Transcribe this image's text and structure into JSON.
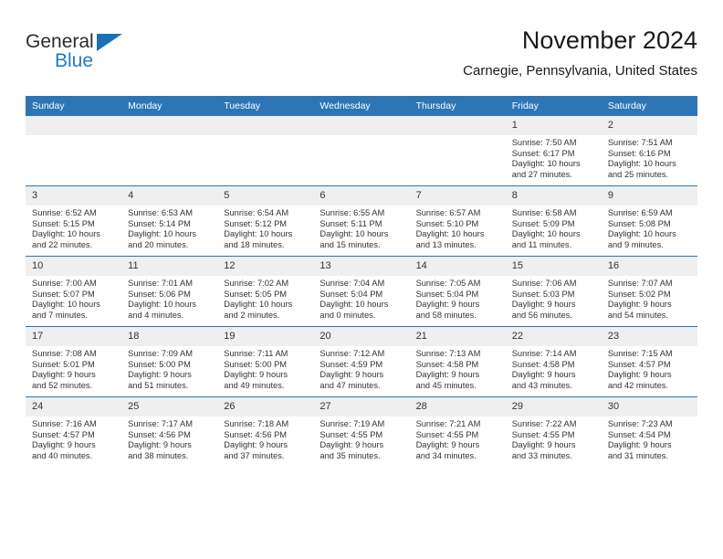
{
  "brand": {
    "logo_text_1": "General",
    "logo_text_2": "Blue",
    "logo_triangle_icon": "triangle-icon",
    "accent_color": "#2e75b6",
    "logo_blue": "#1e7ac4"
  },
  "header": {
    "title": "November 2024",
    "subtitle": "Carnegie, Pennsylvania, United States"
  },
  "calendar": {
    "weekday_headers": [
      "Sunday",
      "Monday",
      "Tuesday",
      "Wednesday",
      "Thursday",
      "Friday",
      "Saturday"
    ],
    "header_bg": "#2e75b6",
    "daynum_bg": "#efefef",
    "weeks": [
      [
        {
          "day": "",
          "lines": []
        },
        {
          "day": "",
          "lines": []
        },
        {
          "day": "",
          "lines": []
        },
        {
          "day": "",
          "lines": []
        },
        {
          "day": "",
          "lines": []
        },
        {
          "day": "1",
          "lines": [
            "Sunrise: 7:50 AM",
            "Sunset: 6:17 PM",
            "Daylight: 10 hours",
            "and 27 minutes."
          ]
        },
        {
          "day": "2",
          "lines": [
            "Sunrise: 7:51 AM",
            "Sunset: 6:16 PM",
            "Daylight: 10 hours",
            "and 25 minutes."
          ]
        }
      ],
      [
        {
          "day": "3",
          "lines": [
            "Sunrise: 6:52 AM",
            "Sunset: 5:15 PM",
            "Daylight: 10 hours",
            "and 22 minutes."
          ]
        },
        {
          "day": "4",
          "lines": [
            "Sunrise: 6:53 AM",
            "Sunset: 5:14 PM",
            "Daylight: 10 hours",
            "and 20 minutes."
          ]
        },
        {
          "day": "5",
          "lines": [
            "Sunrise: 6:54 AM",
            "Sunset: 5:12 PM",
            "Daylight: 10 hours",
            "and 18 minutes."
          ]
        },
        {
          "day": "6",
          "lines": [
            "Sunrise: 6:55 AM",
            "Sunset: 5:11 PM",
            "Daylight: 10 hours",
            "and 15 minutes."
          ]
        },
        {
          "day": "7",
          "lines": [
            "Sunrise: 6:57 AM",
            "Sunset: 5:10 PM",
            "Daylight: 10 hours",
            "and 13 minutes."
          ]
        },
        {
          "day": "8",
          "lines": [
            "Sunrise: 6:58 AM",
            "Sunset: 5:09 PM",
            "Daylight: 10 hours",
            "and 11 minutes."
          ]
        },
        {
          "day": "9",
          "lines": [
            "Sunrise: 6:59 AM",
            "Sunset: 5:08 PM",
            "Daylight: 10 hours",
            "and 9 minutes."
          ]
        }
      ],
      [
        {
          "day": "10",
          "lines": [
            "Sunrise: 7:00 AM",
            "Sunset: 5:07 PM",
            "Daylight: 10 hours",
            "and 7 minutes."
          ]
        },
        {
          "day": "11",
          "lines": [
            "Sunrise: 7:01 AM",
            "Sunset: 5:06 PM",
            "Daylight: 10 hours",
            "and 4 minutes."
          ]
        },
        {
          "day": "12",
          "lines": [
            "Sunrise: 7:02 AM",
            "Sunset: 5:05 PM",
            "Daylight: 10 hours",
            "and 2 minutes."
          ]
        },
        {
          "day": "13",
          "lines": [
            "Sunrise: 7:04 AM",
            "Sunset: 5:04 PM",
            "Daylight: 10 hours",
            "and 0 minutes."
          ]
        },
        {
          "day": "14",
          "lines": [
            "Sunrise: 7:05 AM",
            "Sunset: 5:04 PM",
            "Daylight: 9 hours",
            "and 58 minutes."
          ]
        },
        {
          "day": "15",
          "lines": [
            "Sunrise: 7:06 AM",
            "Sunset: 5:03 PM",
            "Daylight: 9 hours",
            "and 56 minutes."
          ]
        },
        {
          "day": "16",
          "lines": [
            "Sunrise: 7:07 AM",
            "Sunset: 5:02 PM",
            "Daylight: 9 hours",
            "and 54 minutes."
          ]
        }
      ],
      [
        {
          "day": "17",
          "lines": [
            "Sunrise: 7:08 AM",
            "Sunset: 5:01 PM",
            "Daylight: 9 hours",
            "and 52 minutes."
          ]
        },
        {
          "day": "18",
          "lines": [
            "Sunrise: 7:09 AM",
            "Sunset: 5:00 PM",
            "Daylight: 9 hours",
            "and 51 minutes."
          ]
        },
        {
          "day": "19",
          "lines": [
            "Sunrise: 7:11 AM",
            "Sunset: 5:00 PM",
            "Daylight: 9 hours",
            "and 49 minutes."
          ]
        },
        {
          "day": "20",
          "lines": [
            "Sunrise: 7:12 AM",
            "Sunset: 4:59 PM",
            "Daylight: 9 hours",
            "and 47 minutes."
          ]
        },
        {
          "day": "21",
          "lines": [
            "Sunrise: 7:13 AM",
            "Sunset: 4:58 PM",
            "Daylight: 9 hours",
            "and 45 minutes."
          ]
        },
        {
          "day": "22",
          "lines": [
            "Sunrise: 7:14 AM",
            "Sunset: 4:58 PM",
            "Daylight: 9 hours",
            "and 43 minutes."
          ]
        },
        {
          "day": "23",
          "lines": [
            "Sunrise: 7:15 AM",
            "Sunset: 4:57 PM",
            "Daylight: 9 hours",
            "and 42 minutes."
          ]
        }
      ],
      [
        {
          "day": "24",
          "lines": [
            "Sunrise: 7:16 AM",
            "Sunset: 4:57 PM",
            "Daylight: 9 hours",
            "and 40 minutes."
          ]
        },
        {
          "day": "25",
          "lines": [
            "Sunrise: 7:17 AM",
            "Sunset: 4:56 PM",
            "Daylight: 9 hours",
            "and 38 minutes."
          ]
        },
        {
          "day": "26",
          "lines": [
            "Sunrise: 7:18 AM",
            "Sunset: 4:56 PM",
            "Daylight: 9 hours",
            "and 37 minutes."
          ]
        },
        {
          "day": "27",
          "lines": [
            "Sunrise: 7:19 AM",
            "Sunset: 4:55 PM",
            "Daylight: 9 hours",
            "and 35 minutes."
          ]
        },
        {
          "day": "28",
          "lines": [
            "Sunrise: 7:21 AM",
            "Sunset: 4:55 PM",
            "Daylight: 9 hours",
            "and 34 minutes."
          ]
        },
        {
          "day": "29",
          "lines": [
            "Sunrise: 7:22 AM",
            "Sunset: 4:55 PM",
            "Daylight: 9 hours",
            "and 33 minutes."
          ]
        },
        {
          "day": "30",
          "lines": [
            "Sunrise: 7:23 AM",
            "Sunset: 4:54 PM",
            "Daylight: 9 hours",
            "and 31 minutes."
          ]
        }
      ]
    ]
  }
}
